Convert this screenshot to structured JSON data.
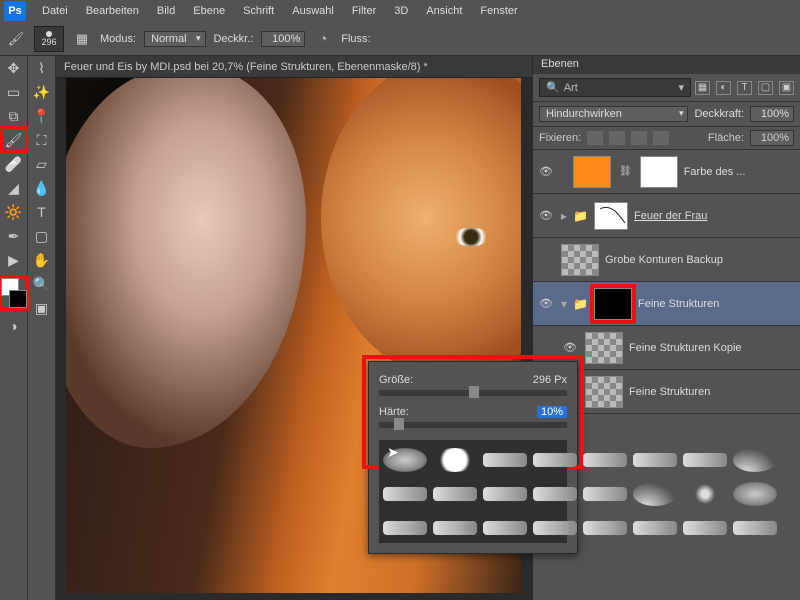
{
  "menu": {
    "items": [
      "Datei",
      "Bearbeiten",
      "Bild",
      "Ebene",
      "Schrift",
      "Auswahl",
      "Filter",
      "3D",
      "Ansicht",
      "Fenster"
    ]
  },
  "optbar": {
    "brush_size": "296",
    "mode_lbl": "Modus:",
    "mode_val": "Normal",
    "opacity_lbl": "Deckkr.:",
    "opacity_val": "100%",
    "flow_lbl": "Fluss:"
  },
  "document": {
    "tab_title": "Feuer und Eis by MDI.psd bei 20,7% (Feine Strukturen, Ebenenmaske/8) *"
  },
  "brush_popup": {
    "size_lbl": "Größe:",
    "size_val": "296 Px",
    "hardness_lbl": "Härte:",
    "hardness_val": "10%"
  },
  "layers_panel": {
    "tab": "Ebenen",
    "search_placeholder": "Art",
    "blend_mode": "Hindurchwirken",
    "opacity_lbl": "Deckkraft:",
    "opacity_val": "100%",
    "fill_lbl": "Fläche:",
    "fill_val": "100%",
    "lock_lbl": "Fixieren:",
    "layers": [
      {
        "name": "Farbe des ...",
        "ul": false
      },
      {
        "name": "Feuer der Frau",
        "ul": true
      },
      {
        "name": "Grobe Konturen Backup",
        "ul": false
      },
      {
        "name": "Feine Strukturen",
        "ul": false
      },
      {
        "name": "Feine Strukturen Kopie",
        "ul": false
      },
      {
        "name": "Feine Strukturen",
        "ul": false
      }
    ]
  }
}
